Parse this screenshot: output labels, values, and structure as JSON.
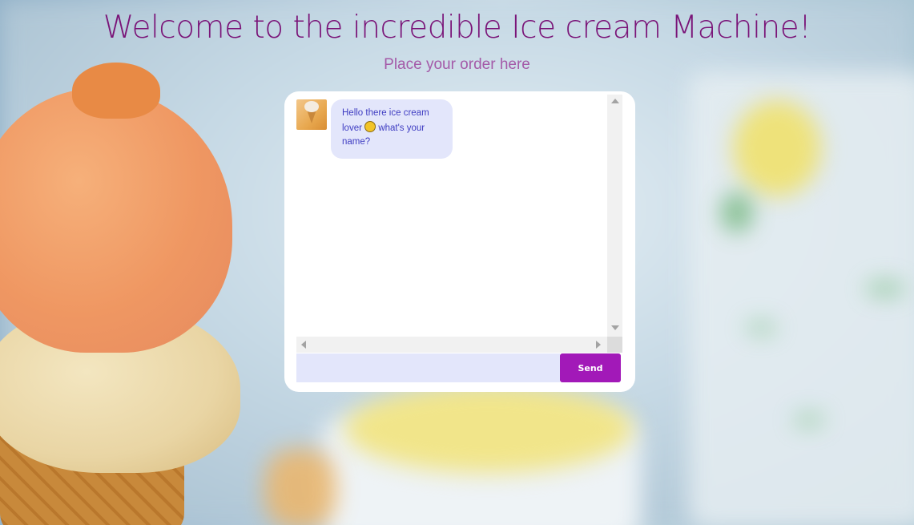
{
  "header": {
    "title": "Welcome to the incredible Ice cream Machine!",
    "subtitle": "Place your order here"
  },
  "chat": {
    "messages": [
      {
        "sender": "bot",
        "avatar_icon": "ice-cream-avatar",
        "text_before_emoji": "Hello there ice cream lover ",
        "emoji_icon": "smiling-face-emoji",
        "text_after_emoji": " what's your name?"
      }
    ],
    "input": {
      "value": "",
      "placeholder": ""
    },
    "send_label": "Send"
  },
  "colors": {
    "title": "#7a1478",
    "subtitle": "#a45aa8",
    "bubble_bg": "#e3e6fb",
    "bubble_text": "#3f3dc2",
    "send_button": "#a219b8"
  }
}
